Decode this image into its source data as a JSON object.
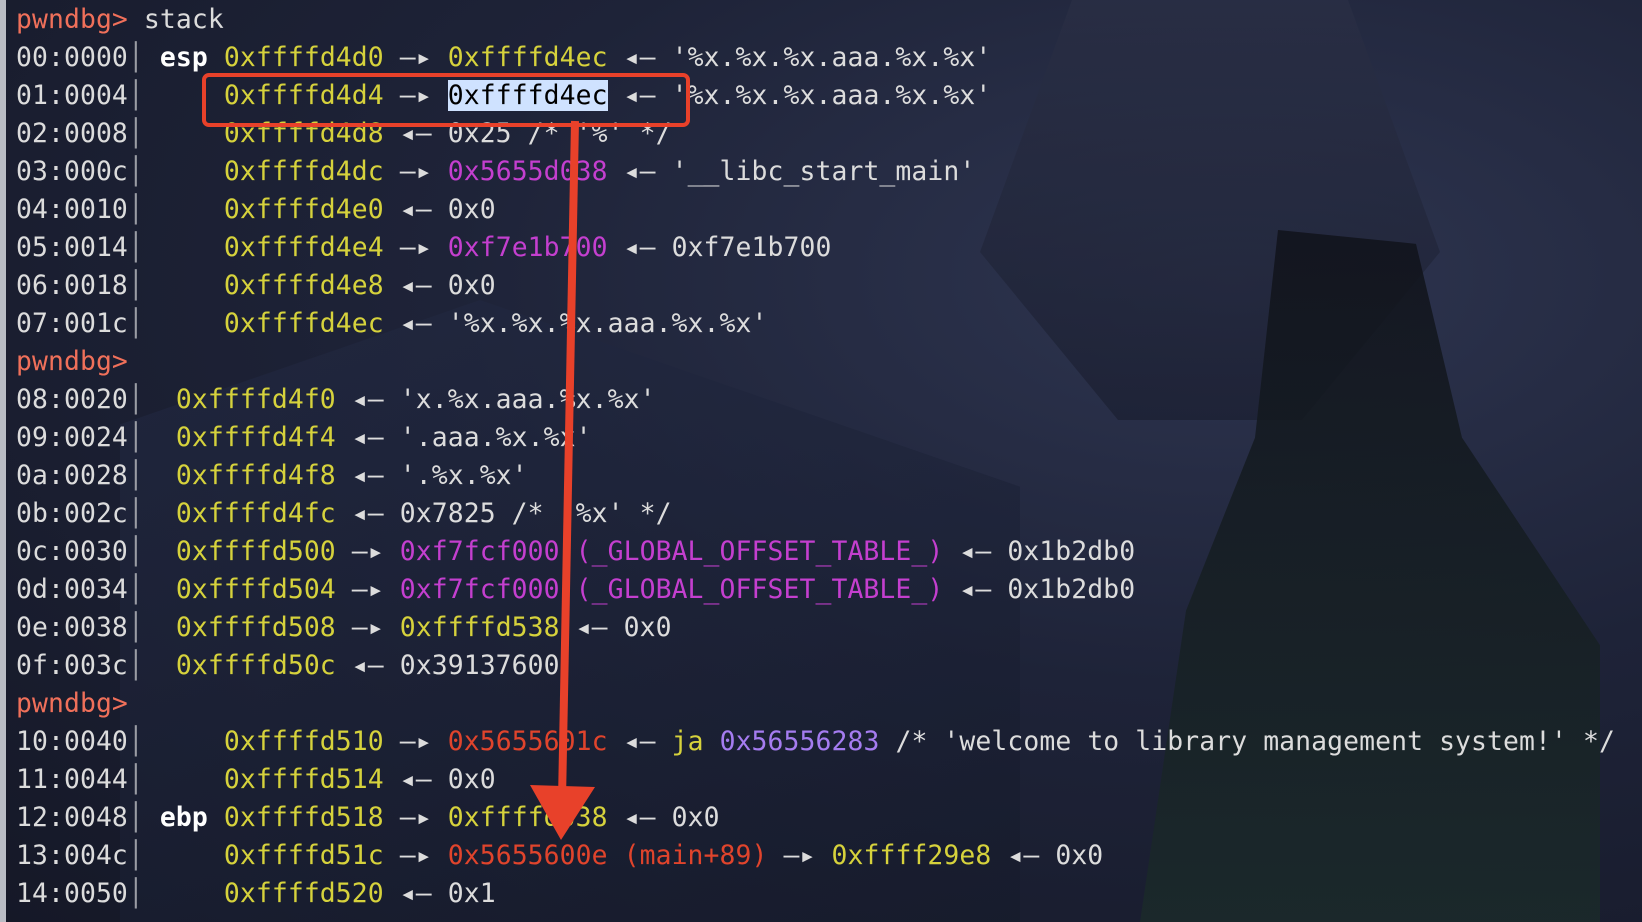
{
  "colors": {
    "prompt": "#f0705a",
    "address": "#d6d23c",
    "code": "#c43fcf",
    "text_ptr": "#e0442c",
    "symbol": "#a57cf0",
    "annotation": "#e8412a"
  },
  "lines": [
    [
      [
        "pwndbg>",
        "pr"
      ],
      [
        " stack",
        "w"
      ]
    ],
    [
      [
        "00:0000",
        "w"
      ],
      [
        "│",
        "sep"
      ],
      [
        " ",
        "w"
      ],
      [
        "esp",
        "b"
      ],
      [
        " ",
        "w"
      ],
      [
        "0xffffd4d0",
        "y"
      ],
      [
        " —▸ ",
        "w"
      ],
      [
        "0xffffd4ec",
        "y"
      ],
      [
        " ◂— '%x.%x.%x.aaa.%x.%x'",
        "w"
      ]
    ],
    [
      [
        "01:0004",
        "w"
      ],
      [
        "│",
        "sep"
      ],
      [
        "     ",
        "w"
      ],
      [
        "0xffffd4d4",
        "y"
      ],
      [
        " —▸ ",
        "w"
      ],
      [
        "0xffffd4ec",
        "sel"
      ],
      [
        " ◂— '%x.%x.%x.aaa.%x.%x'",
        "w"
      ]
    ],
    [
      [
        "02:0008",
        "w"
      ],
      [
        "│",
        "sep"
      ],
      [
        "     ",
        "w"
      ],
      [
        "0xffffd4d8",
        "y"
      ],
      [
        " ◂— 0x25 /* '%' */",
        "w"
      ]
    ],
    [
      [
        "03:000c",
        "w"
      ],
      [
        "│",
        "sep"
      ],
      [
        "     ",
        "w"
      ],
      [
        "0xffffd4dc",
        "y"
      ],
      [
        " —▸ ",
        "w"
      ],
      [
        "0x5655d038",
        "m"
      ],
      [
        " ◂— '__libc_start_main'",
        "w"
      ]
    ],
    [
      [
        "04:0010",
        "w"
      ],
      [
        "│",
        "sep"
      ],
      [
        "     ",
        "w"
      ],
      [
        "0xffffd4e0",
        "y"
      ],
      [
        " ◂— 0x0",
        "w"
      ]
    ],
    [
      [
        "05:0014",
        "w"
      ],
      [
        "│",
        "sep"
      ],
      [
        "     ",
        "w"
      ],
      [
        "0xffffd4e4",
        "y"
      ],
      [
        " —▸ ",
        "w"
      ],
      [
        "0xf7e1b700",
        "m"
      ],
      [
        " ◂— 0xf7e1b700",
        "w"
      ]
    ],
    [
      [
        "06:0018",
        "w"
      ],
      [
        "│",
        "sep"
      ],
      [
        "     ",
        "w"
      ],
      [
        "0xffffd4e8",
        "y"
      ],
      [
        " ◂— 0x0",
        "w"
      ]
    ],
    [
      [
        "07:001c",
        "w"
      ],
      [
        "│",
        "sep"
      ],
      [
        "     ",
        "w"
      ],
      [
        "0xffffd4ec",
        "y"
      ],
      [
        " ◂— '%x.%x.%x.aaa.%x.%x'",
        "w"
      ]
    ],
    [
      [
        "pwndbg>",
        "pr"
      ]
    ],
    [
      [
        "08:0020",
        "w"
      ],
      [
        "│",
        "sep"
      ],
      [
        "  ",
        "w"
      ],
      [
        "0xffffd4f0",
        "y"
      ],
      [
        " ◂— 'x.%x.aaa.%x.%x'",
        "w"
      ]
    ],
    [
      [
        "09:0024",
        "w"
      ],
      [
        "│",
        "sep"
      ],
      [
        "  ",
        "w"
      ],
      [
        "0xffffd4f4",
        "y"
      ],
      [
        " ◂— '.aaa.%x.%x'",
        "w"
      ]
    ],
    [
      [
        "0a:0028",
        "w"
      ],
      [
        "│",
        "sep"
      ],
      [
        "  ",
        "w"
      ],
      [
        "0xffffd4f8",
        "y"
      ],
      [
        " ◂— '.%x.%x'",
        "w"
      ]
    ],
    [
      [
        "0b:002c",
        "w"
      ],
      [
        "│",
        "sep"
      ],
      [
        "  ",
        "w"
      ],
      [
        "0xffffd4fc",
        "y"
      ],
      [
        " ◂— 0x7825 /* '%x' */",
        "w"
      ]
    ],
    [
      [
        "0c:0030",
        "w"
      ],
      [
        "│",
        "sep"
      ],
      [
        "  ",
        "w"
      ],
      [
        "0xffffd500",
        "y"
      ],
      [
        " —▸ ",
        "w"
      ],
      [
        "0xf7fcf000 (_GLOBAL_OFFSET_TABLE_)",
        "m"
      ],
      [
        " ◂— 0x1b2db0",
        "w"
      ]
    ],
    [
      [
        "0d:0034",
        "w"
      ],
      [
        "│",
        "sep"
      ],
      [
        "  ",
        "w"
      ],
      [
        "0xffffd504",
        "y"
      ],
      [
        " —▸ ",
        "w"
      ],
      [
        "0xf7fcf000 (_GLOBAL_OFFSET_TABLE_)",
        "m"
      ],
      [
        " ◂— 0x1b2db0",
        "w"
      ]
    ],
    [
      [
        "0e:0038",
        "w"
      ],
      [
        "│",
        "sep"
      ],
      [
        "  ",
        "w"
      ],
      [
        "0xffffd508",
        "y"
      ],
      [
        " —▸ ",
        "w"
      ],
      [
        "0xffffd538",
        "y"
      ],
      [
        " ◂— 0x0",
        "w"
      ]
    ],
    [
      [
        "0f:003c",
        "w"
      ],
      [
        "│",
        "sep"
      ],
      [
        "  ",
        "w"
      ],
      [
        "0xffffd50c",
        "y"
      ],
      [
        " ◂— 0x39137600",
        "w"
      ]
    ],
    [
      [
        "pwndbg>",
        "pr"
      ]
    ],
    [
      [
        "10:0040",
        "w"
      ],
      [
        "│",
        "sep"
      ],
      [
        "     ",
        "w"
      ],
      [
        "0xffffd510",
        "y"
      ],
      [
        " —▸ ",
        "w"
      ],
      [
        "0x5655601c",
        "r"
      ],
      [
        " ◂— ",
        "w"
      ],
      [
        "ja",
        "y"
      ],
      [
        " ",
        "w"
      ],
      [
        "0x56556283",
        "p"
      ],
      [
        " /* 'welcome to library management system!' */",
        "w"
      ]
    ],
    [
      [
        "11:0044",
        "w"
      ],
      [
        "│",
        "sep"
      ],
      [
        "     ",
        "w"
      ],
      [
        "0xffffd514",
        "y"
      ],
      [
        " ◂— 0x0",
        "w"
      ]
    ],
    [
      [
        "12:0048",
        "w"
      ],
      [
        "│",
        "sep"
      ],
      [
        " ",
        "w"
      ],
      [
        "ebp",
        "b"
      ],
      [
        " ",
        "w"
      ],
      [
        "0xffffd518",
        "y"
      ],
      [
        " —▸ ",
        "w"
      ],
      [
        "0xffffd538",
        "y"
      ],
      [
        " ◂— 0x0",
        "w"
      ]
    ],
    [
      [
        "13:004c",
        "w"
      ],
      [
        "│",
        "sep"
      ],
      [
        "     ",
        "w"
      ],
      [
        "0xffffd51c",
        "y"
      ],
      [
        " —▸ ",
        "w"
      ],
      [
        "0x5655600e (main+89)",
        "r"
      ],
      [
        " —▸ ",
        "w"
      ],
      [
        "0xffff29e8",
        "y"
      ],
      [
        " ◂— 0x0",
        "w"
      ]
    ],
    [
      [
        "14:0050",
        "w"
      ],
      [
        "│",
        "sep"
      ],
      [
        "     ",
        "w"
      ],
      [
        "0xffffd520",
        "y"
      ],
      [
        " ◂— 0x1",
        "w"
      ]
    ]
  ]
}
